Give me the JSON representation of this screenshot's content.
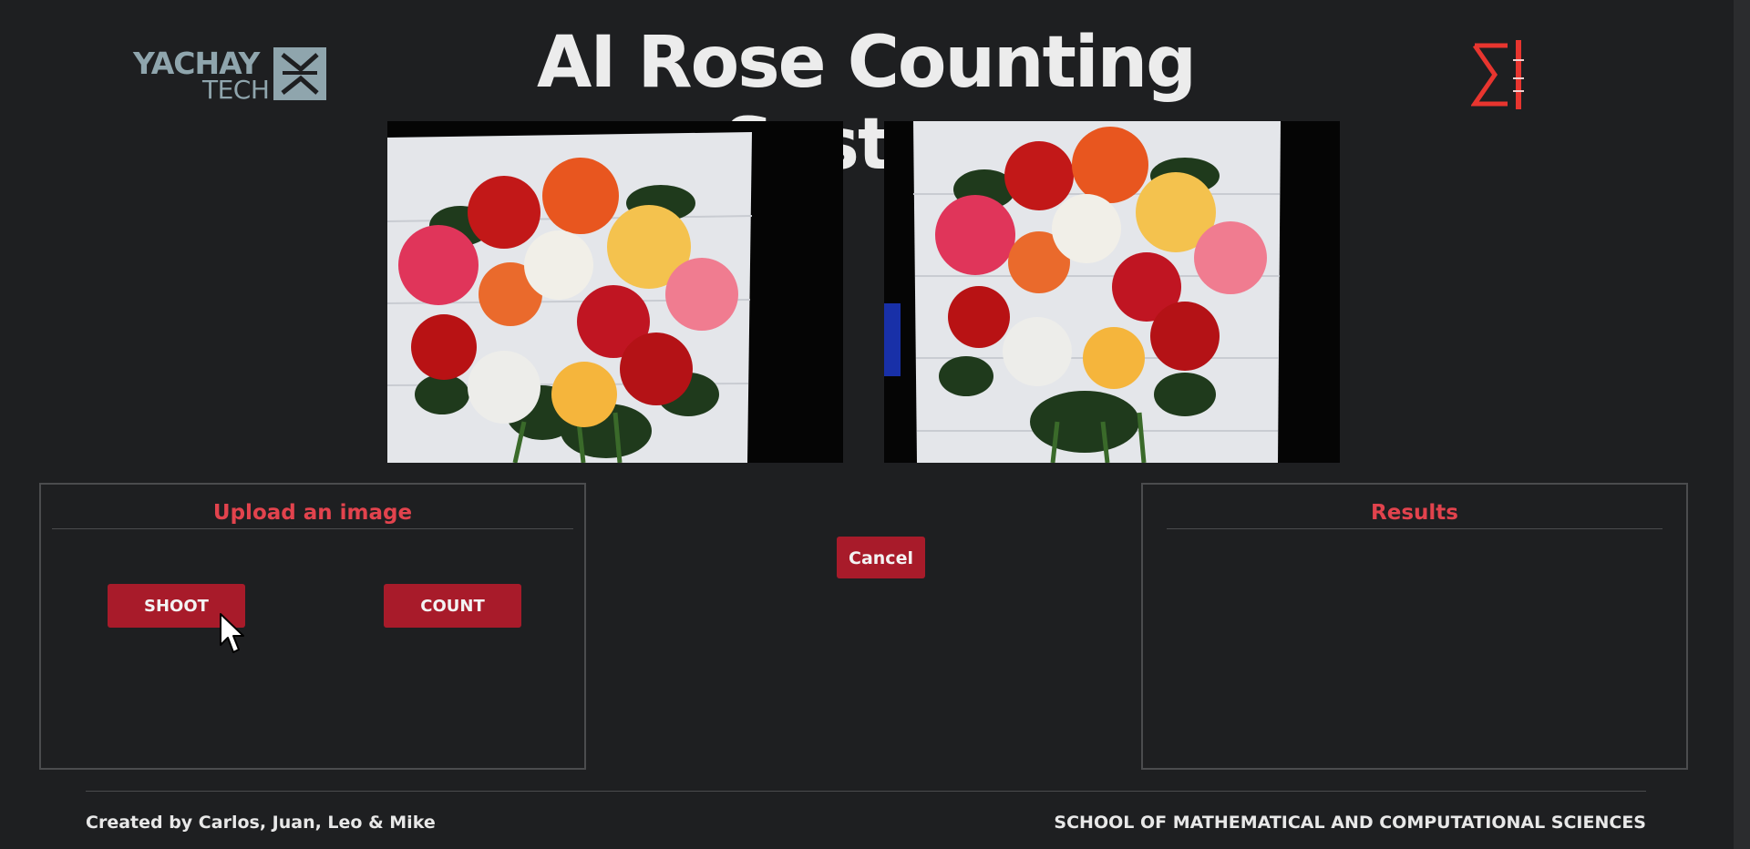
{
  "header": {
    "title": "AI Rose Counting System",
    "logo_left": {
      "line1": "YACHAY",
      "line2": "TECH",
      "icon": "yachay-tech-logo"
    },
    "logo_right": {
      "icon": "sigma-logo"
    }
  },
  "images": {
    "left": {
      "subject": "rose bouquet photo"
    },
    "right": {
      "subject": "rose bouquet photo"
    }
  },
  "upload_panel": {
    "title": "Upload an image",
    "shoot_label": "SHOOT",
    "count_label": "COUNT"
  },
  "cancel_label": "Cancel",
  "results_panel": {
    "title": "Results"
  },
  "footer": {
    "credits": "Created by Carlos, Juan, Leo & Mike",
    "school": "SCHOOL OF MATHEMATICAL AND COMPUTATIONAL SCIENCES"
  },
  "colors": {
    "background": "#1e1f21",
    "accent": "#e2434d",
    "button": "#a81b2a",
    "logo_gray": "#8fa5ad",
    "sigma_red": "#e8352f"
  }
}
